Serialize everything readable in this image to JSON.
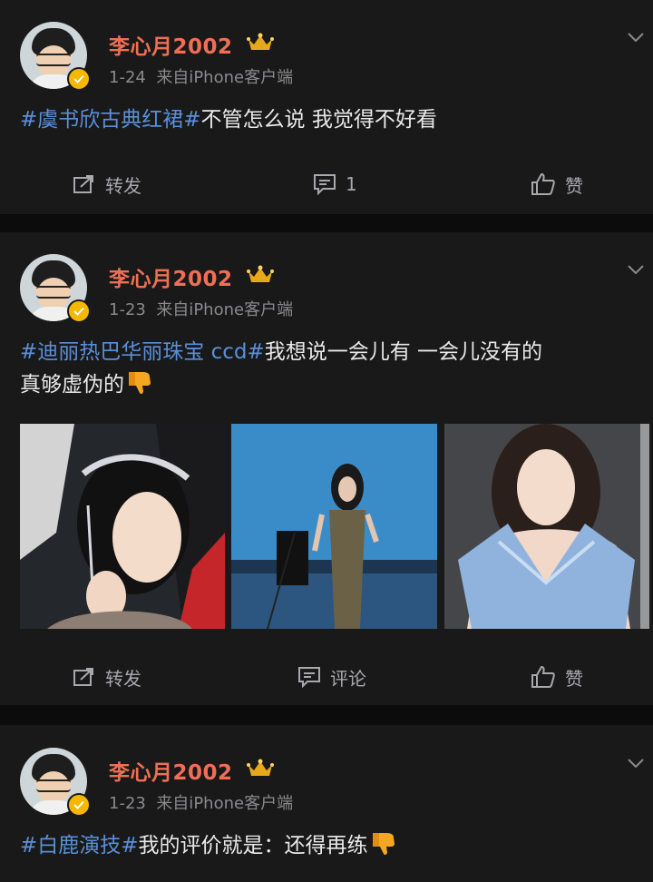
{
  "posts": [
    {
      "username": "李心月2002",
      "date": "1-24",
      "source": "来自iPhone客户端",
      "hashtag": "#虞书欣古典红裙#",
      "text": "不管怎么说 我觉得不好看",
      "actions": {
        "repost": "转发",
        "comment": "1",
        "like": "赞"
      }
    },
    {
      "username": "李心月2002",
      "date": "1-23",
      "source": "来自iPhone客户端",
      "hashtag": "#迪丽热巴华丽珠宝 ccd#",
      "text_line1": "我想说一会儿有 一会儿没有的",
      "text_line2": "真够虚伪的",
      "actions": {
        "repost": "转发",
        "comment": "评论",
        "like": "赞"
      }
    },
    {
      "username": "李心月2002",
      "date": "1-23",
      "source": "来自iPhone客户端",
      "hashtag": "#白鹿演技#",
      "text": "我的评价就是：还得再练"
    }
  ],
  "icons": {
    "thumbs_down": "thumbs-down-emoji",
    "repost": "repost-icon",
    "comment": "comment-icon",
    "like": "like-icon",
    "crown": "crown-badge-icon",
    "verified": "verified-badge-icon",
    "menu": "chevron-down-icon"
  },
  "colors": {
    "username": "#ef6f55",
    "hashtag": "#5b8fd9",
    "background": "#191919",
    "meta": "#8a8a8e"
  }
}
